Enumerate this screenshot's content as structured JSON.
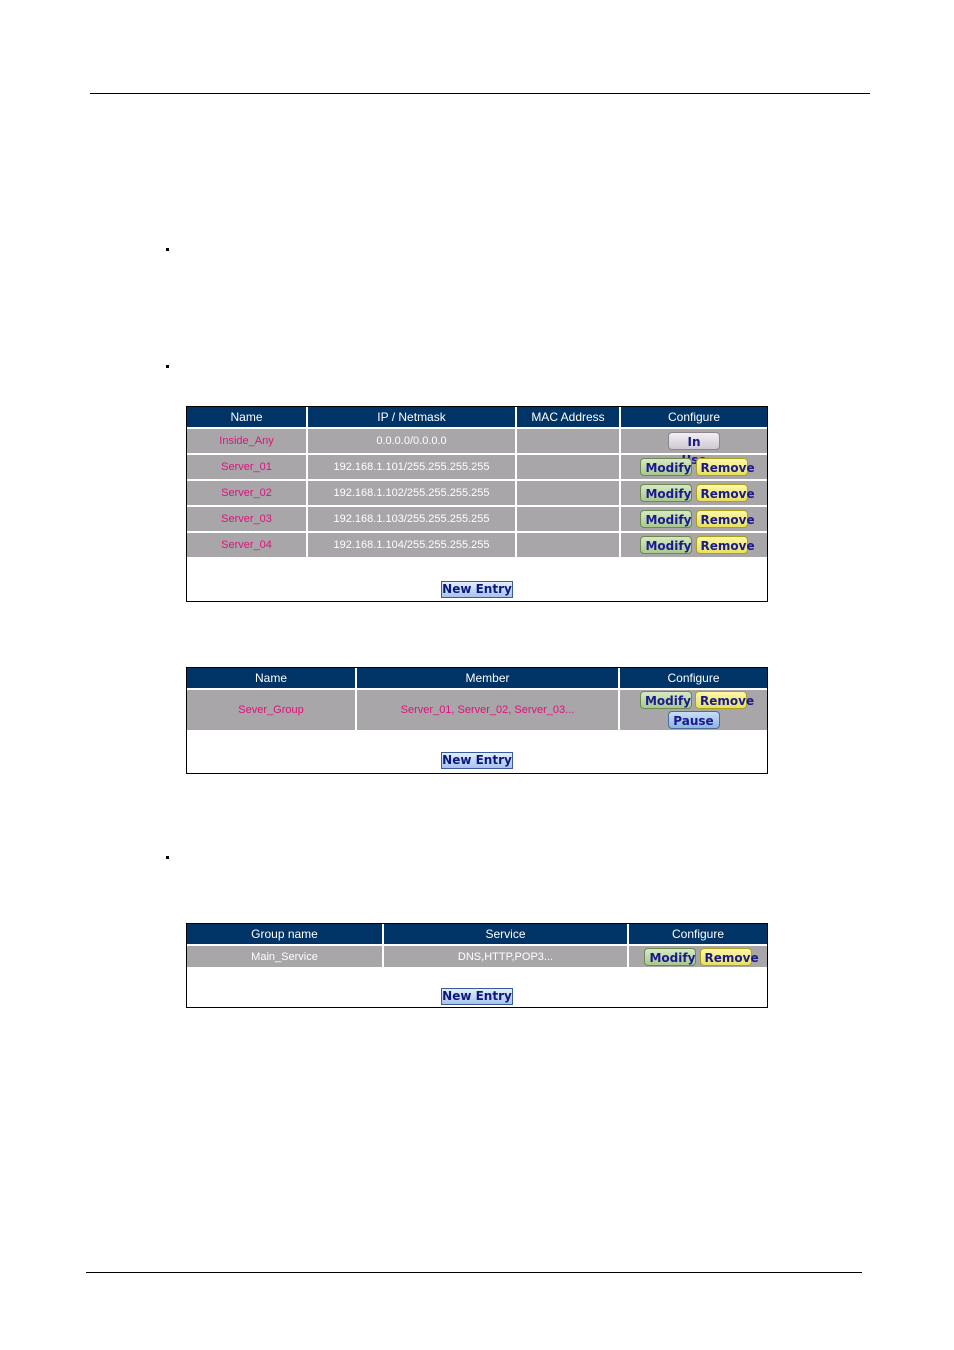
{
  "address_table": {
    "headers": [
      "Name",
      "IP / Netmask",
      "MAC Address",
      "Configure"
    ],
    "rows": [
      {
        "name": "Inside_Any",
        "ip": "0.0.0.0/0.0.0.0",
        "mac": "",
        "actions": [
          "In Use"
        ]
      },
      {
        "name": "Server_01",
        "ip": "192.168.1.101/255.255.255.255",
        "mac": "",
        "actions": [
          "Modify",
          "Remove"
        ]
      },
      {
        "name": "Server_02",
        "ip": "192.168.1.102/255.255.255.255",
        "mac": "",
        "actions": [
          "Modify",
          "Remove"
        ]
      },
      {
        "name": "Server_03",
        "ip": "192.168.1.103/255.255.255.255",
        "mac": "",
        "actions": [
          "Modify",
          "Remove"
        ]
      },
      {
        "name": "Server_04",
        "ip": "192.168.1.104/255.255.255.255",
        "mac": "",
        "actions": [
          "Modify",
          "Remove"
        ]
      }
    ],
    "new_entry_label": "New Entry"
  },
  "group_table": {
    "headers": [
      "Name",
      "Member",
      "Configure"
    ],
    "rows": [
      {
        "name": "Sever_Group",
        "member": "Server_01, Server_02, Server_03...",
        "actions": [
          "Modify",
          "Remove",
          "Pause"
        ]
      }
    ],
    "new_entry_label": "New Entry"
  },
  "service_table": {
    "headers": [
      "Group name",
      "Service",
      "Configure"
    ],
    "rows": [
      {
        "name": "Main_Service",
        "service": "DNS,HTTP,POP3...",
        "actions": [
          "Modify",
          "Remove"
        ]
      }
    ],
    "new_entry_label": "New Entry"
  },
  "colors": {
    "header_bg": "#003366",
    "row_bg": "#a8a6a8",
    "name_text": "#e0107f"
  }
}
